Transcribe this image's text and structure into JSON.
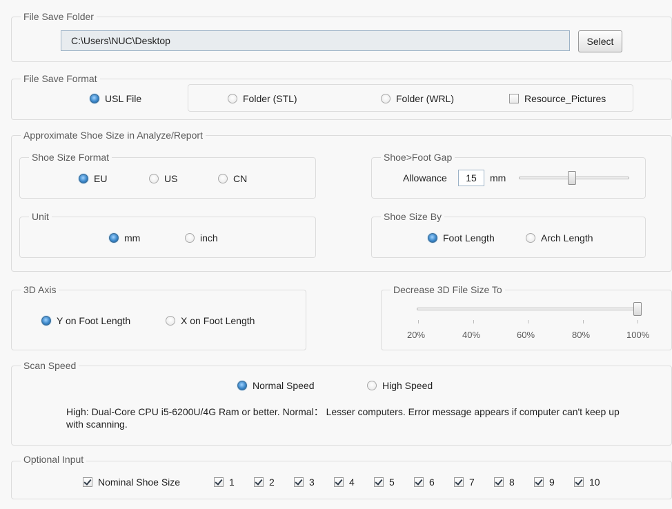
{
  "file_save_folder": {
    "legend": "File Save Folder",
    "path": "C:\\Users\\NUC\\Desktop",
    "select_label": "Select"
  },
  "file_save_format": {
    "legend": "File Save Format",
    "usl_label": "USL File",
    "stl_label": "Folder (STL)",
    "wrl_label": "Folder (WRL)",
    "resource_label": "Resource_Pictures",
    "selected": "USL File",
    "resource_checked": false
  },
  "approx_shoe_size": {
    "legend": "Approximate Shoe Size in Analyze/Report",
    "shoe_size_format": {
      "legend": "Shoe Size Format",
      "options": [
        "EU",
        "US",
        "CN"
      ],
      "selected": "EU"
    },
    "gap": {
      "legend": "Shoe>Foot Gap",
      "allowance_label": "Allowance",
      "value": "15",
      "unit": "mm",
      "slider_fraction": 0.48
    },
    "unit": {
      "legend": "Unit",
      "options": [
        "mm",
        "inch"
      ],
      "selected": "mm"
    },
    "size_by": {
      "legend": "Shoe Size By",
      "options": [
        "Foot Length",
        "Arch Length"
      ],
      "selected": "Foot Length"
    }
  },
  "axis_3d": {
    "legend": "3D Axis",
    "options": [
      "Y on Foot Length",
      "X on Foot Length"
    ],
    "selected": "Y on Foot Length"
  },
  "decrease_size": {
    "legend": "Decrease 3D File Size To",
    "ticks": [
      "20%",
      "40%",
      "60%",
      "80%",
      "100%"
    ],
    "value_percent": 100
  },
  "scan_speed": {
    "legend": "Scan Speed",
    "options": [
      "Normal Speed",
      "High Speed"
    ],
    "selected": "Normal Speed",
    "note": "High: Dual-Core CPU i5-6200U/4G Ram or better. Normal： Lesser computers. Error message appears if computer can't keep up with scanning."
  },
  "optional_input": {
    "legend": "Optional Input",
    "items": [
      {
        "label": "Nominal Shoe Size",
        "checked": true
      },
      {
        "label": "1",
        "checked": true
      },
      {
        "label": "2",
        "checked": true
      },
      {
        "label": "3",
        "checked": true
      },
      {
        "label": "4",
        "checked": true
      },
      {
        "label": "5",
        "checked": true
      },
      {
        "label": "6",
        "checked": true
      },
      {
        "label": "7",
        "checked": true
      },
      {
        "label": "8",
        "checked": true
      },
      {
        "label": "9",
        "checked": true
      },
      {
        "label": "10",
        "checked": true
      }
    ]
  }
}
